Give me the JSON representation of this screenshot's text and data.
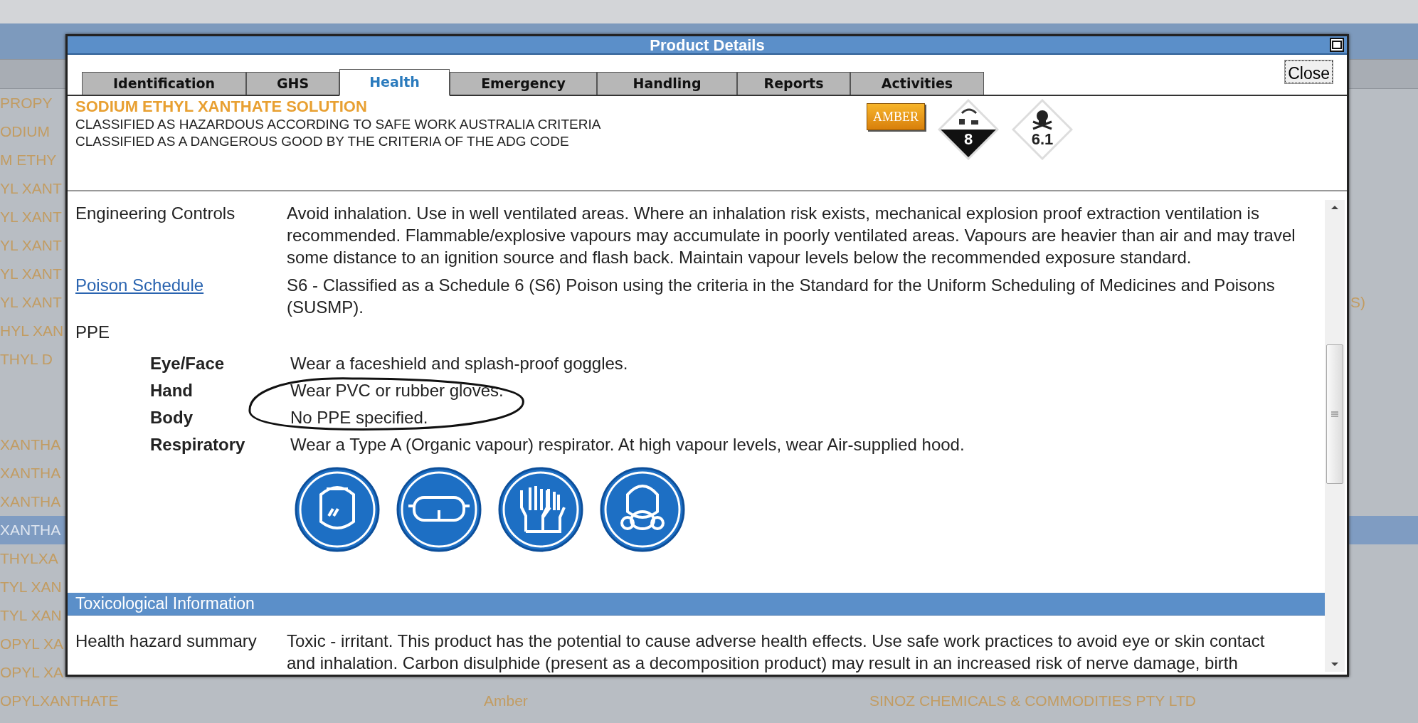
{
  "background": {
    "rows": [
      {
        "column_1": "PROPY",
        "selected": false
      },
      {
        "column_1": "ODIUM",
        "selected": false
      },
      {
        "column_1": "M ETHY",
        "selected": false
      },
      {
        "column_1": "YL XANT",
        "selected": false
      },
      {
        "column_1": "YL XANT",
        "selected": false
      },
      {
        "column_1": "YL XANT",
        "selected": false
      },
      {
        "column_1": "YL XANT",
        "selected": false
      },
      {
        "column_1": "YL XANT",
        "column_4": "S)",
        "selected": false
      },
      {
        "column_1": "HYL XAN",
        "selected": false
      },
      {
        "column_1": "THYL D",
        "selected": false
      },
      {
        "selected": false
      },
      {
        "selected": false
      },
      {
        "column_1": "XANTHA",
        "selected": false
      },
      {
        "column_1": "XANTHA",
        "selected": false
      },
      {
        "column_1": "XANTHA",
        "selected": false
      },
      {
        "column_1": "XANTHA",
        "selected": true
      },
      {
        "column_1": "THYLXA",
        "selected": false
      },
      {
        "column_1": "TYL XAN",
        "selected": false
      },
      {
        "column_1": "TYL XAN",
        "selected": false
      },
      {
        "column_1": "OPYL XA",
        "selected": false
      },
      {
        "column_1": "OPYL XA",
        "selected": false
      },
      {
        "column_1": "OPYLXANTHATE",
        "column_2": "Amber",
        "column_3": "SINOZ CHEMICALS & COMMODITIES PTY LTD",
        "selected": false
      }
    ]
  },
  "dialog": {
    "title": "Product Details",
    "close": "Close",
    "tabs": [
      {
        "label": "Identification",
        "selected": false
      },
      {
        "label": "GHS",
        "selected": false
      },
      {
        "label": "Health",
        "selected": true
      },
      {
        "label": "Emergency",
        "selected": false
      },
      {
        "label": "Handling",
        "selected": false
      },
      {
        "label": "Reports",
        "selected": false
      },
      {
        "label": "Activities",
        "selected": false
      }
    ],
    "product": {
      "name": "SODIUM ETHYL XANTHATE SOLUTION",
      "classifications": [
        "CLASSIFIED AS HAZARDOUS ACCORDING TO SAFE WORK AUSTRALIA CRITERIA",
        "CLASSIFIED AS A DANGEROUS GOOD BY THE CRITERIA OF THE ADG CODE"
      ],
      "badges": [
        {
          "kind": "rating",
          "label": "AMBER"
        },
        {
          "kind": "corrosive",
          "label": "8"
        },
        {
          "kind": "toxic",
          "label": "6.1"
        }
      ]
    },
    "sections": [
      {
        "kind": "row",
        "label": "Engineering Controls",
        "text": "Avoid inhalation. Use in well ventilated areas. Where an inhalation risk exists, mechanical explosion proof extraction ventilation is recommended. Flammable/explosive vapours may accumulate in poorly ventilated areas. Vapours are heavier than air and may travel some distance to an ignition source and flash back. Maintain vapour levels below the recommended exposure standard."
      },
      {
        "kind": "link",
        "label": "Poison Schedule",
        "text": "S6 - Classified as a Schedule 6 (S6) Poison using the criteria in the Standard for the Uniform Scheduling of Medicines and Poisons (SUSMP)."
      },
      {
        "kind": "group",
        "label": "PPE",
        "items": [
          {
            "label": "Eye/Face",
            "text": "Wear a faceshield and splash-proof goggles."
          },
          {
            "label": "Hand",
            "text": "Wear PVC or rubber gloves."
          },
          {
            "label": "Body",
            "text": "No PPE specified."
          },
          {
            "label": "Respiratory",
            "text": "Wear a Type A (Organic vapour) respirator. At high vapour levels, wear Air-supplied hood."
          }
        ]
      },
      {
        "kind": "header",
        "label": "Toxicological Information"
      },
      {
        "kind": "row",
        "label": "Health hazard summary",
        "text": "Toxic - irritant. This product has the potential to cause adverse health effects. Use safe work practices to avoid eye or skin contact and inhalation. Carbon disulphide (present as a decomposition product) may result in an increased risk of nerve damage, birth"
      }
    ]
  }
}
